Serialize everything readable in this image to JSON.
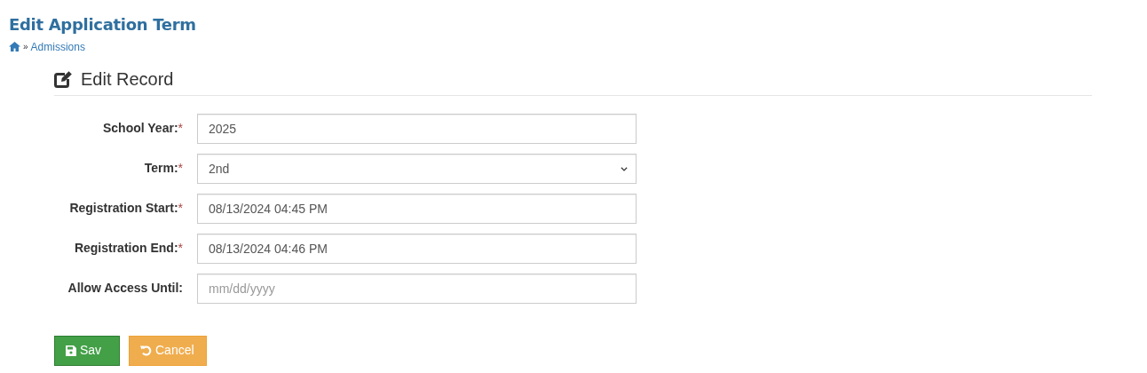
{
  "page_title": "Edit Application Term",
  "breadcrumb": {
    "separator": "»",
    "items": [
      {
        "label": "Admissions"
      }
    ]
  },
  "panel_title": "Edit Record",
  "fields": [
    {
      "label": "School Year:",
      "required": true,
      "kind": "text",
      "value": "2025"
    },
    {
      "label": "Term:",
      "required": true,
      "kind": "select",
      "value": "2nd"
    },
    {
      "label": "Registration Start:",
      "required": true,
      "kind": "text",
      "value": "08/13/2024 04:45 PM"
    },
    {
      "label": "Registration End:",
      "required": true,
      "kind": "text",
      "value": "08/13/2024 04:46 PM"
    },
    {
      "label": "Allow Access Until:",
      "required": false,
      "kind": "text",
      "placeholder": "mm/dd/yyyy"
    }
  ],
  "buttons": [
    {
      "label": "Sav",
      "kind": "save"
    },
    {
      "label": "Cancel",
      "kind": "cancel"
    }
  ],
  "required_mark": "*"
}
